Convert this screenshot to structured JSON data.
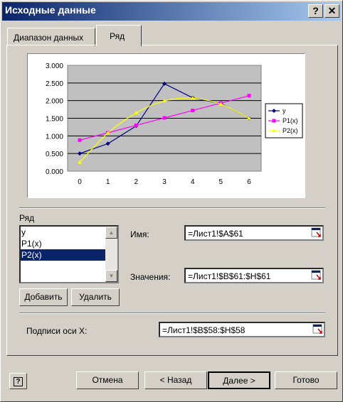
{
  "window": {
    "title": "Исходные данные",
    "help_btn": "?",
    "close_btn": "✕"
  },
  "tabs": [
    {
      "label": "Диапазон данных"
    },
    {
      "label": "Ряд"
    }
  ],
  "chart_data": {
    "type": "line",
    "categories": [
      "0",
      "1",
      "2",
      "3",
      "4",
      "5",
      "6"
    ],
    "y_ticks": [
      "3.000",
      "2.500",
      "2.000",
      "1.500",
      "1.000",
      "0.500",
      "0.000"
    ],
    "ylim": [
      0,
      3
    ],
    "grid": true,
    "legend_position": "right",
    "series": [
      {
        "name": "y",
        "color": "#000080",
        "marker": "diamond",
        "smooth": false,
        "values": [
          0.5,
          0.78,
          1.28,
          2.48,
          2.08,
          1.92,
          1.5
        ]
      },
      {
        "name": "P1(x)",
        "color": "#ff00ff",
        "marker": "square",
        "smooth": false,
        "values": [
          0.88,
          1.09,
          1.3,
          1.51,
          1.72,
          1.93,
          2.14
        ]
      },
      {
        "name": "P2(x)",
        "color": "#ffff00",
        "marker": "triangle",
        "smooth": true,
        "values": [
          0.25,
          1.08,
          1.65,
          1.99,
          2.07,
          1.9,
          1.5
        ]
      }
    ]
  },
  "series_section": {
    "label": "Ряд",
    "items": [
      "y",
      "P1(x)",
      "P2(x)"
    ],
    "selected_index": 2
  },
  "name_field": {
    "label": "Имя:",
    "value": "=Лист1!$A$61"
  },
  "values_field": {
    "label": "Значения:",
    "value": "=Лист1!$B$61:$H$61"
  },
  "buttons": {
    "add": "Добавить",
    "remove": "Удалить"
  },
  "xlabels_field": {
    "label": "Подписи оси X:",
    "value": "=Лист1!$B$58:$H$58"
  },
  "footer": {
    "help": "?",
    "cancel": "Отмена",
    "back": "< Назад",
    "next": "Далее >",
    "finish": "Готово"
  }
}
